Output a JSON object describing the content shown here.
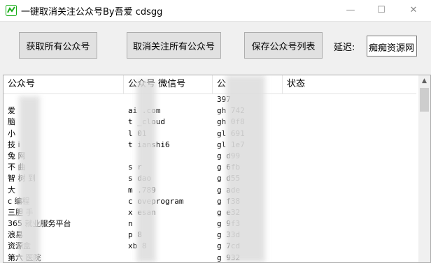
{
  "window": {
    "title": "一键取消关注公众号By吾爱 cdsgg",
    "minimize": "—",
    "maximize": "☐",
    "close": "✕"
  },
  "toolbar": {
    "fetch_label": "获取所有公众号",
    "unfollow_label": "取消关注所有公众号",
    "save_label": "保存公众号列表",
    "delay_label": "延迟:",
    "delay_value": "痴痴资源网"
  },
  "list": {
    "columns": [
      "公众号",
      "公众号 微信号",
      "公",
      "状态"
    ],
    "rows": [
      {
        "name": "",
        "wxid": "",
        "gh": "397"
      },
      {
        "name": "爱",
        "wxid": "ai .com",
        "gh": "gh 742"
      },
      {
        "name": "脑",
        "wxid": "t _cloud",
        "gh": "gh 0f8"
      },
      {
        "name": "小",
        "wxid": "l 01",
        "gh": "gl 691"
      },
      {
        "name": "技 i",
        "wxid": "t ianshi6",
        "gh": "gl 1e7"
      },
      {
        "name": "兔 网",
        "wxid": "",
        "gh": "g d99"
      },
      {
        "name": "不 曲",
        "wxid": "s r",
        "gh": "g 6fb"
      },
      {
        "name": "智 树 到",
        "wxid": "s dao",
        "gh": "g d55"
      },
      {
        "name": "大",
        "wxid": "m .789",
        "gh": "g ade"
      },
      {
        "name": "c 编程",
        "wxid": "c oveprogram",
        "gh": "g f38"
      },
      {
        "name": "三胆 手",
        "wxid": "x esan",
        "gh": "g e32"
      },
      {
        "name": "365 就业服务平台",
        "wxid": "n",
        "gh": "g 9f3"
      },
      {
        "name": "浪易",
        "wxid": "p 8",
        "gh": "g 33d"
      },
      {
        "name": "资源盒",
        "wxid": "xb 8",
        "gh": "g 7cd"
      },
      {
        "name": "第六 医院",
        "wxid": "",
        "gh": "g 932"
      }
    ]
  },
  "colors": {
    "window_bg": "#f0f0f0",
    "button_bg": "#e1e1e1",
    "button_border": "#adadad",
    "list_bg": "#ffffff",
    "icon_green": "#1aad19"
  }
}
